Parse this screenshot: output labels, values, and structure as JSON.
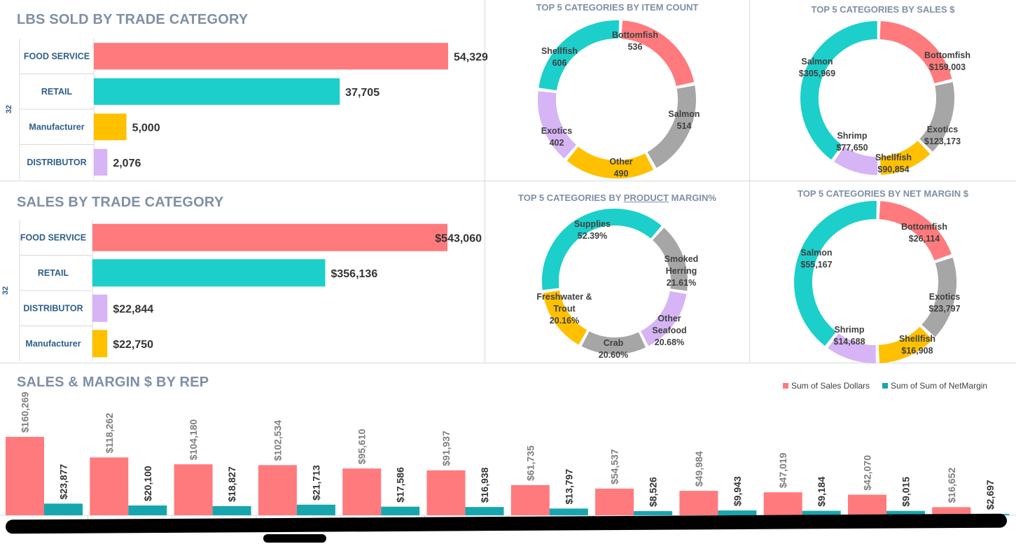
{
  "colors": {
    "red": "#ff7a7d",
    "teal": "#1ccfca",
    "gold": "#ffc000",
    "lavender": "#d6b4f5",
    "gray": "#a6a6a6",
    "darkteal": "#17a6ae",
    "title": "#7f8fa6"
  },
  "lbs_panel": {
    "title": "LBS SOLD BY TRADE CATEGORY",
    "axis_label": "32"
  },
  "sales_panel": {
    "title": "SALES BY TRADE CATEGORY",
    "axis_label": "32"
  },
  "donut_titles": {
    "item_count": "TOP 5 CATEGORIES BY ITEM COUNT",
    "sales_dollars": "TOP 5 CATEGORIES BY SALES $",
    "margin_pct_pre": "TOP 5 CATEGORIES BY ",
    "margin_pct_u": "PRODUCT",
    "margin_pct_post": " MARGIN%",
    "net_margin": "TOP 5 CATEGORIES BY NET MARGIN $"
  },
  "rep_panel": {
    "title": "SALES & MARGIN $ BY REP"
  },
  "chart_data": [
    {
      "id": "lbs",
      "type": "bar",
      "orientation": "horizontal",
      "title": "LBS SOLD BY TRADE CATEGORY",
      "categories": [
        "FOOD SERVICE",
        "RETAIL",
        "Manufacturer",
        "DISTRIBUTOR"
      ],
      "values": [
        54329,
        37705,
        5000,
        2076
      ],
      "labels": [
        "54,329",
        "37,705",
        "5,000",
        "2,076"
      ],
      "colors": [
        "#ff7a7d",
        "#1ccfca",
        "#ffc000",
        "#d6b4f5"
      ],
      "xlim": [
        0,
        54329
      ]
    },
    {
      "id": "sales",
      "type": "bar",
      "orientation": "horizontal",
      "title": "SALES BY TRADE CATEGORY",
      "categories": [
        "FOOD SERVICE",
        "RETAIL",
        "DISTRIBUTOR",
        "Manufacturer"
      ],
      "values": [
        543060,
        356136,
        22844,
        22750
      ],
      "labels": [
        "$543,060",
        "$356,136",
        "$22,844",
        "$22,750"
      ],
      "colors": [
        "#ff7a7d",
        "#1ccfca",
        "#d6b4f5",
        "#ffc000"
      ],
      "xlim": [
        0,
        543060
      ]
    },
    {
      "id": "item_count",
      "type": "pie",
      "title": "TOP 5 CATEGORIES BY ITEM COUNT",
      "slices": [
        {
          "name": "Bottomfish",
          "value": 536,
          "label": "536",
          "color": "#ff7a7d"
        },
        {
          "name": "Salmon",
          "value": 514,
          "label": "514",
          "color": "#a6a6a6"
        },
        {
          "name": "Other",
          "value": 490,
          "label": "490",
          "color": "#ffc000"
        },
        {
          "name": "Exotics",
          "value": 402,
          "label": "402",
          "color": "#d6b4f5"
        },
        {
          "name": "Shellfish",
          "value": 606,
          "label": "606",
          "color": "#1ccfca"
        }
      ]
    },
    {
      "id": "sales_dollars",
      "type": "pie",
      "title": "TOP 5 CATEGORIES BY SALES $",
      "slices": [
        {
          "name": "Bottomfish",
          "value": 159003,
          "label": "$159,003",
          "color": "#ff7a7d"
        },
        {
          "name": "Exotics",
          "value": 123173,
          "label": "$123,173",
          "color": "#a6a6a6"
        },
        {
          "name": "Shellfish",
          "value": 90854,
          "label": "$90,854",
          "color": "#ffc000"
        },
        {
          "name": "Shrimp",
          "value": 77650,
          "label": "$77,650",
          "color": "#d6b4f5"
        },
        {
          "name": "Salmon",
          "value": 305969,
          "label": "$305,969",
          "color": "#1ccfca"
        }
      ]
    },
    {
      "id": "margin_pct",
      "type": "pie",
      "title": "TOP 5 CATEGORIES BY PRODUCT MARGIN%",
      "slices": [
        {
          "name": "Smoked Herring",
          "value": 21.61,
          "label": "21.61%",
          "color": "#a6a6a6"
        },
        {
          "name": "Other Seafood",
          "value": 20.68,
          "label": "20.68%",
          "color": "#d6b4f5"
        },
        {
          "name": "Crab",
          "value": 20.6,
          "label": "20.60%",
          "color": "#a6a6a6"
        },
        {
          "name": "Freshwater & Trout",
          "value": 20.16,
          "label": "20.16%",
          "color": "#ffc000"
        },
        {
          "name": "Supplies",
          "value": 52.39,
          "label": "52.39%",
          "color": "#1ccfca"
        }
      ]
    },
    {
      "id": "net_margin",
      "type": "pie",
      "title": "TOP 5 CATEGORIES BY NET MARGIN $",
      "slices": [
        {
          "name": "Bottomfish",
          "value": 26114,
          "label": "$26,114",
          "color": "#ff7a7d"
        },
        {
          "name": "Exotics",
          "value": 23797,
          "label": "$23,797",
          "color": "#a6a6a6"
        },
        {
          "name": "Shellfish",
          "value": 16908,
          "label": "$16,908",
          "color": "#ffc000"
        },
        {
          "name": "Shrimp",
          "value": 14688,
          "label": "$14,688",
          "color": "#d6b4f5"
        },
        {
          "name": "Salmon",
          "value": 55167,
          "label": "$55,167",
          "color": "#1ccfca"
        }
      ]
    },
    {
      "id": "rep",
      "type": "bar",
      "title": "SALES & MARGIN $ BY REP",
      "legend": "top-right",
      "series": [
        {
          "name": "Sum of Sales Dollars",
          "color": "#ff7a7d",
          "values": [
            160269,
            118262,
            104180,
            102534,
            95610,
            91937,
            61735,
            54537,
            49984,
            47019,
            42070,
            16652
          ],
          "labels": [
            "$160,269",
            "$118,262",
            "$104,180",
            "$102,534",
            "$95,610",
            "$91,937",
            "$61,735",
            "$54,537",
            "$49,984",
            "$47,019",
            "$42,070",
            "$16,652"
          ]
        },
        {
          "name": "Sum of Sum of NetMargin",
          "color": "#17a6ae",
          "values": [
            23877,
            20100,
            18827,
            21713,
            17586,
            16938,
            13797,
            8526,
            9943,
            9184,
            9015,
            2697
          ],
          "labels": [
            "$23,877",
            "$20,100",
            "$18,827",
            "$21,713",
            "$17,586",
            "$16,938",
            "$13,797",
            "$8,526",
            "$9,943",
            "$9,184",
            "$9,015",
            "$2,697"
          ]
        }
      ],
      "ylim": [
        0,
        160269
      ]
    }
  ]
}
